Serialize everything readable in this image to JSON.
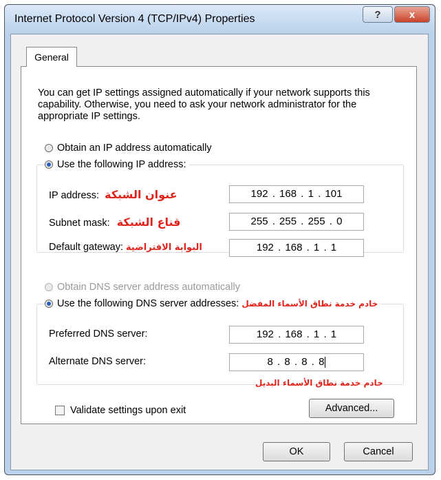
{
  "window": {
    "title": "Internet Protocol Version 4 (TCP/IPv4) Properties",
    "help_label": "?",
    "close_label": "x"
  },
  "tab": {
    "general": "General"
  },
  "description": "You can get IP settings assigned automatically if your network supports this capability. Otherwise, you need to ask your network administrator for the appropriate IP settings.",
  "ip": {
    "auto_label": "Obtain an IP address automatically",
    "manual_label": "Use the following IP address:",
    "address_label": "IP address:",
    "address_arabic": "عنوان الشبكة",
    "address_value": "192 . 168 .  1  . 101",
    "subnet_label": "Subnet mask:",
    "subnet_arabic": "قناع الشبكة",
    "subnet_value": "255 . 255 . 255 .  0",
    "gateway_label": "Default gateway:",
    "gateway_arabic": "البوابة الافتراضية",
    "gateway_value": "192 . 168 .  1  .  1"
  },
  "dns": {
    "auto_label": "Obtain DNS server address automatically",
    "manual_label": "Use the following DNS server addresses:",
    "manual_arabic": "خادم خدمة نطاق الأسماء المفضل",
    "preferred_label": "Preferred DNS server:",
    "preferred_value": "192 . 168 .  1  .  1",
    "alternate_label": "Alternate DNS server:",
    "alternate_value": "8  .  8  .  8  .  8",
    "alternate_arabic": "خادم خدمة نطاق الأسماء البديل"
  },
  "validate_label": "Validate settings upon exit",
  "buttons": {
    "advanced": "Advanced...",
    "ok": "OK",
    "cancel": "Cancel"
  },
  "colors": {
    "annotation": "#e0241b",
    "radio_selected": "#2a5fbf"
  }
}
